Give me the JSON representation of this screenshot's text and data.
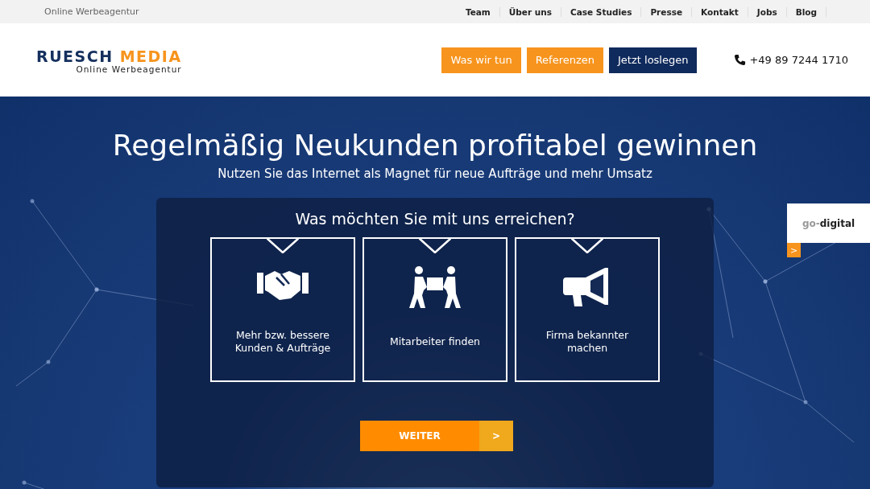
{
  "topbar": {
    "tagline": "Online Werbeagentur",
    "links": [
      {
        "label": "Team"
      },
      {
        "label": "Über uns"
      },
      {
        "label": "Case Studies"
      },
      {
        "label": "Presse"
      },
      {
        "label": "Kontakt"
      },
      {
        "label": "Jobs"
      },
      {
        "label": "Blog"
      }
    ]
  },
  "header": {
    "logo": {
      "word_1": "RUESCH",
      "word_2": "MEDIA",
      "subtitle": "Online Werbeagentur"
    },
    "buttons": [
      {
        "label": "Was wir tun",
        "kind": "secondary"
      },
      {
        "label": "Referenzen",
        "kind": "secondary"
      },
      {
        "label": "Jetzt loslegen",
        "kind": "primary"
      }
    ],
    "phone": "+49 89 7244 1710"
  },
  "hero": {
    "title": "Regelmäßig Neukunden profitabel gewinnen",
    "subtitle": "Nutzen Sie das Internet als Magnet für neue Aufträge und mehr Umsatz",
    "panel": {
      "question": "Was möchten Sie mit uns erreichen?",
      "options": [
        {
          "label": "Mehr bzw. bessere Kunden & Aufträge",
          "kind": "handshake"
        },
        {
          "label": "Mitarbeiter finden",
          "kind": "people"
        },
        {
          "label": "Firma bekannter machen",
          "kind": "megaphone"
        }
      ],
      "next_button": {
        "label": "WEITER",
        "arrow": ">"
      }
    }
  },
  "badge": {
    "word_1": "go-",
    "word_2": "digital",
    "arrow": ">"
  }
}
